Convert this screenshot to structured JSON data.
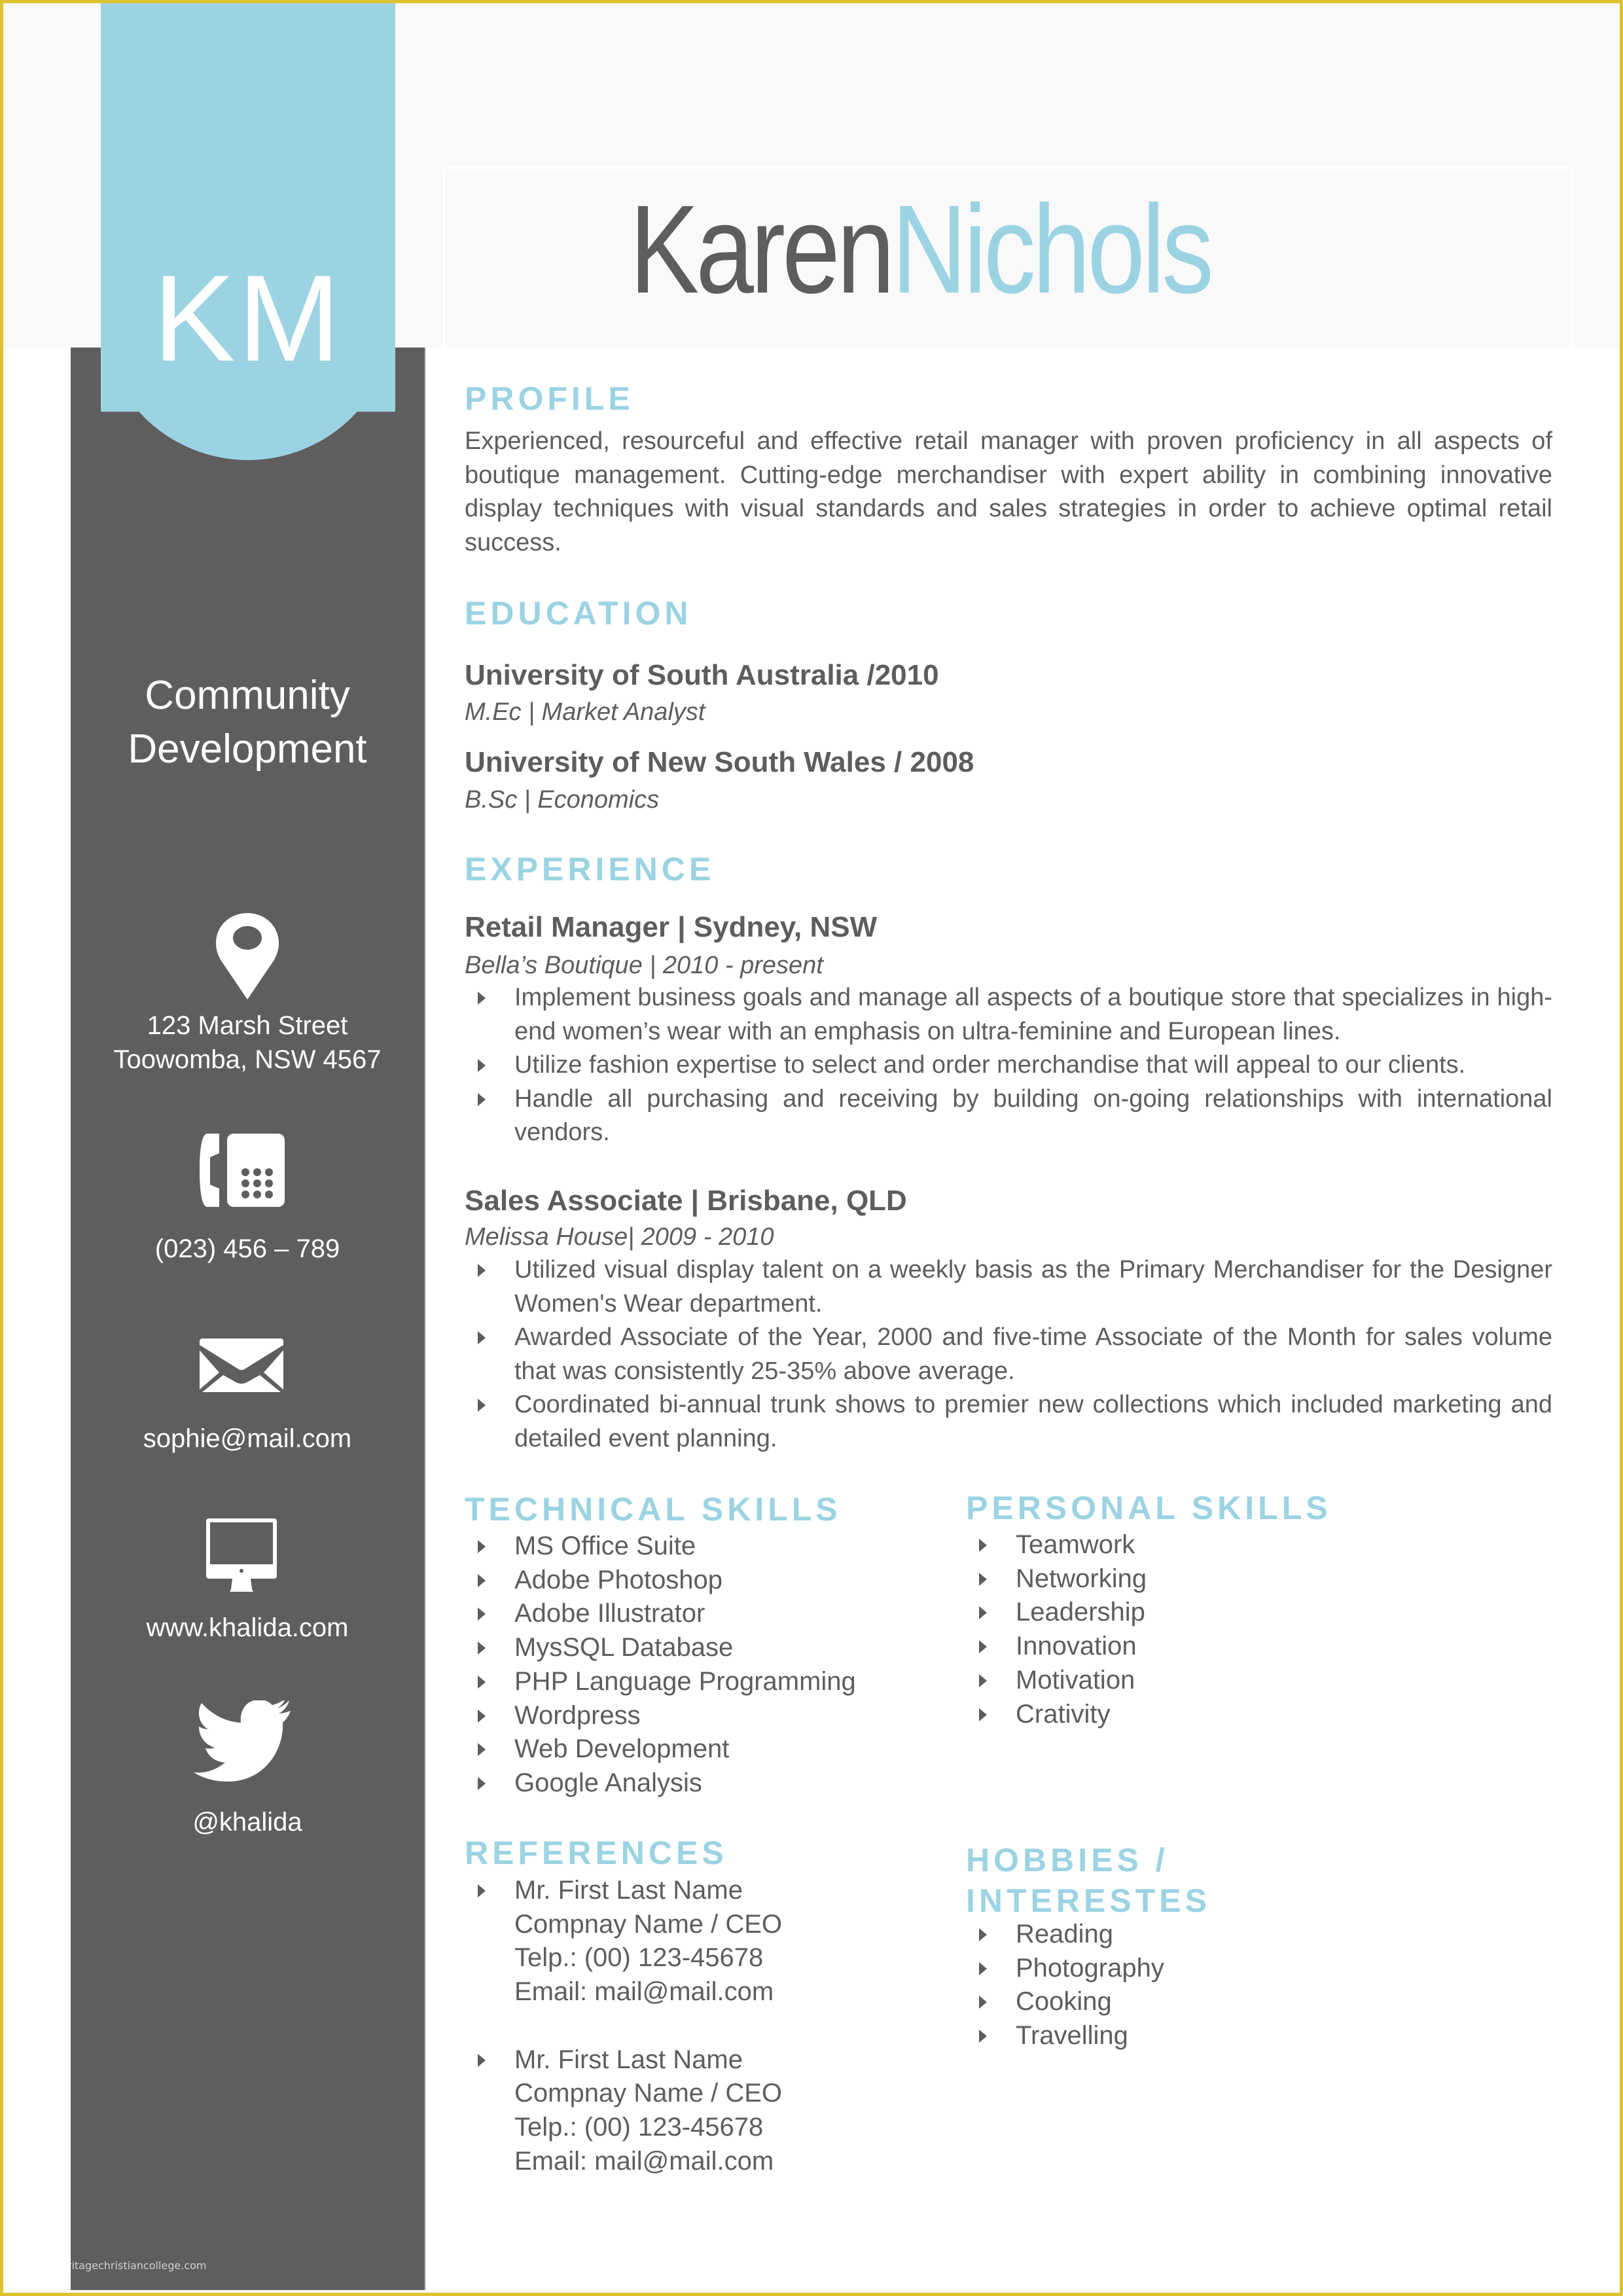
{
  "header": {
    "initials": "KM",
    "first_name": "Karen",
    "last_name": "Nichols"
  },
  "colors": {
    "accent": "#9bd3e3",
    "sidebar": "#5e5e5e",
    "text": "#5d5d5d",
    "header_band": "#f9f9f9",
    "frame": "#dcc232"
  },
  "sidebar": {
    "title_line1": "Community",
    "title_line2": "Development",
    "contacts": [
      {
        "icon": "map-pin-icon",
        "lines": [
          "123 Marsh Street",
          "Toowomba, NSW 4567"
        ]
      },
      {
        "icon": "telephone-icon",
        "lines": [
          "(023) 456 – 789"
        ]
      },
      {
        "icon": "envelope-icon",
        "lines": [
          "sophie@mail.com"
        ]
      },
      {
        "icon": "monitor-icon",
        "lines": [
          "www.khalida.com"
        ]
      },
      {
        "icon": "twitter-bird-icon",
        "lines": [
          "@khalida"
        ]
      }
    ]
  },
  "profile": {
    "heading": "PROFILE",
    "text": "Experienced, resourceful and effective retail manager with proven proficiency in all aspects of boutique management. Cutting-edge merchandiser with expert ability in combining innovative display techniques with visual standards and sales strategies in order to achieve optimal retail success."
  },
  "education": {
    "heading": "EDUCATION",
    "entries": [
      {
        "title": "University of South Australia /2010",
        "detail": "M.Ec | Market Analyst"
      },
      {
        "title": "University of New South Wales / 2008",
        "detail": "B.Sc | Economics"
      }
    ]
  },
  "experience": {
    "heading": "EXPERIENCE",
    "jobs": [
      {
        "title": "Retail Manager | Sydney, NSW",
        "detail": "Bella’s Boutique | 2010 - present",
        "bullets": [
          "Implement business goals and manage all aspects of a boutique store that specializes in high-end women’s wear with an emphasis on ultra-feminine and European lines.",
          "Utilize fashion expertise to select and order merchandise that will appeal to our clients.",
          "Handle all purchasing and receiving by building on-going relationships with international vendors."
        ]
      },
      {
        "title": "Sales Associate | Brisbane, QLD",
        "detail": "Melissa House| 2009 - 2010",
        "bullets": [
          "Utilized visual display talent on a weekly basis as the Primary Merchandiser for the Designer Women's Wear department.",
          "Awarded Associate of the Year, 2000 and five-time Associate of the Month for sales volume that was consistently 25-35% above average.",
          "Coordinated bi-annual trunk shows to premier new collections which included marketing and detailed event planning."
        ]
      }
    ]
  },
  "technical_skills": {
    "heading": "TECHNICAL SKILLS",
    "items": [
      "MS Office Suite",
      "Adobe Photoshop",
      "Adobe Illustrator",
      "MysSQL Database",
      "PHP Language Programming",
      "Wordpress",
      "Web Development",
      "Google Analysis"
    ]
  },
  "personal_skills": {
    "heading": "PERSONAL SKILLS",
    "items": [
      "Teamwork",
      "Networking",
      "Leadership",
      "Innovation",
      "Motivation",
      "Crativity"
    ]
  },
  "references": {
    "heading": "REFERENCES",
    "entries": [
      {
        "name": "Mr. First Last Name",
        "company": "Compnay Name / CEO",
        "phone": "Telp.: (00) 123-45678",
        "email": "Email: mail@mail.com"
      },
      {
        "name": "Mr. First Last Name",
        "company": "Compnay Name / CEO",
        "phone": "Telp.: (00) 123-45678",
        "email": "Email: mail@mail.com"
      }
    ]
  },
  "hobbies": {
    "heading_line1": "HOBBIES /",
    "heading_line2": "INTERESTES",
    "items": [
      "Reading",
      "Photography",
      "Cooking",
      "Travelling"
    ]
  },
  "watermark": "www.heritagechristiancollege.com"
}
